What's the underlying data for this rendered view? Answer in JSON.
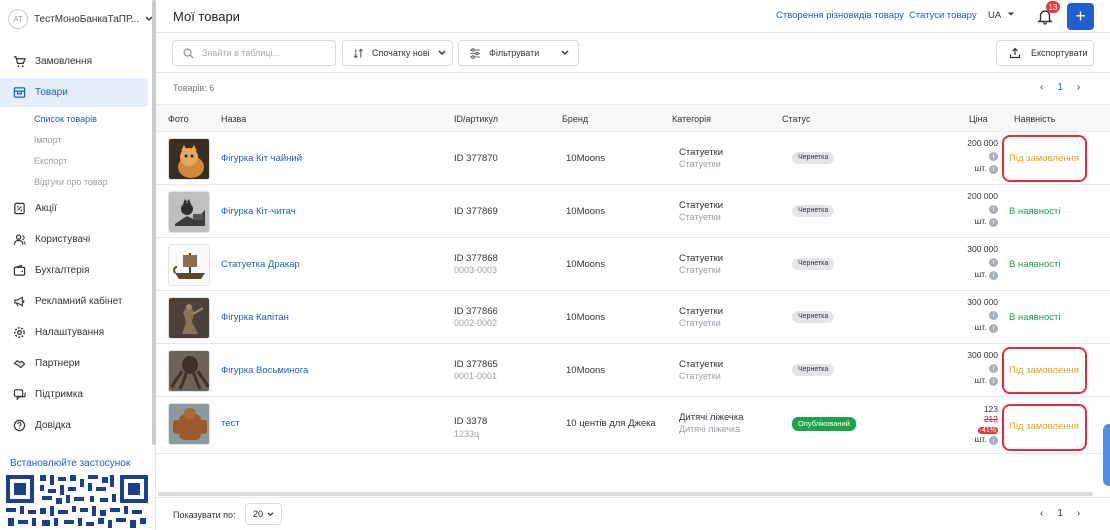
{
  "sidebar": {
    "avatar": "АТ",
    "store_name": "ТестМоноБанкаТаПР...",
    "items": [
      {
        "label": "Замовлення",
        "icon": "cart-icon"
      },
      {
        "label": "Товари",
        "icon": "box-icon",
        "active": true
      },
      {
        "label": "Акції",
        "icon": "percent-tag-icon"
      },
      {
        "label": "Користувачі",
        "icon": "users-icon"
      },
      {
        "label": "Бухгалтерія",
        "icon": "wallet-icon"
      },
      {
        "label": "Рекламний кабінет",
        "icon": "megaphone-icon"
      },
      {
        "label": "Налаштування",
        "icon": "gear-icon"
      },
      {
        "label": "Партнери",
        "icon": "handshake-icon"
      },
      {
        "label": "Підтримка",
        "icon": "chat-icon"
      },
      {
        "label": "Довідка",
        "icon": "help-circle-icon"
      }
    ],
    "sub_items": [
      "Список товарів",
      "Імпорт",
      "Експорт",
      "Відгуки про товар"
    ],
    "install_label": "Встановлюйте застосунок"
  },
  "header": {
    "title": "Мої товари",
    "link_variants": "Створення різновидів товару",
    "link_statuses": "Статуси товару",
    "lang": "UA",
    "notifications": "13"
  },
  "toolbar": {
    "search_placeholder": "Знайти в таблиці...",
    "sort_label": "Спочатку нові",
    "filter_label": "Фільтрувати",
    "export_label": "Експортувати"
  },
  "table": {
    "count_label": "Товарів: 6",
    "page": "1",
    "columns": [
      "Фото",
      "Назва",
      "ID/артикул",
      "Бренд",
      "Категорія",
      "Статус",
      "Ціна",
      "Наявність"
    ],
    "rows": [
      {
        "name": "Фігурка Кіт чайний",
        "id": "ID 377870",
        "sku": "",
        "brand": "10Moons",
        "cat": "Статуетки",
        "cat2": "Статуетки",
        "status": "Чернетка",
        "price": "200 000",
        "unit": "шт.",
        "avail": "Під замовлення"
      },
      {
        "name": "Фігурка Кіт-читач",
        "id": "ID 377869",
        "sku": "",
        "brand": "10Moons",
        "cat": "Статуетки",
        "cat2": "Статуетки",
        "status": "Чернетка",
        "price": "200 000",
        "unit": "шт.",
        "avail": "В наявності"
      },
      {
        "name": "Статуетка Дракар",
        "id": "ID 377868",
        "sku": "0003-0003",
        "brand": "10Moons",
        "cat": "Статуетки",
        "cat2": "Статуетки",
        "status": "Чернетка",
        "price": "300 000",
        "unit": "шт.",
        "avail": "В наявності"
      },
      {
        "name": "Фігурка Капітан",
        "id": "ID 377866",
        "sku": "0002-0002",
        "brand": "10Moons",
        "cat": "Статуетки",
        "cat2": "Статуетки",
        "status": "Чернетка",
        "price": "300 000",
        "unit": "шт.",
        "avail": "В наявності"
      },
      {
        "name": "Фігурка Восьминога",
        "id": "ID 377865",
        "sku": "0001-0001",
        "brand": "10Moons",
        "cat": "Статуетки",
        "cat2": "Статуетки",
        "status": "Чернетка",
        "price": "300 000",
        "unit": "шт.",
        "avail": "Під замовлення"
      },
      {
        "name": "тест",
        "id": "ID 3378",
        "sku": "1233ц",
        "brand": "10 центів для Джека",
        "cat": "Дитячі ліжечка",
        "cat2": "Дитячі ліжечка",
        "status": "Опублікований",
        "price": "123",
        "old_price": "212",
        "discount": "-41%",
        "unit": "шт.",
        "avail": "Під замовлення"
      }
    ]
  },
  "footer": {
    "per_page_label": "Показувати по:",
    "per_page_value": "20",
    "page": "1"
  },
  "colors": {
    "accent": "#1d5fc2",
    "in_stock": "#1fa14a",
    "on_order": "#e8a51a",
    "highlight_box": "#e0303b"
  }
}
